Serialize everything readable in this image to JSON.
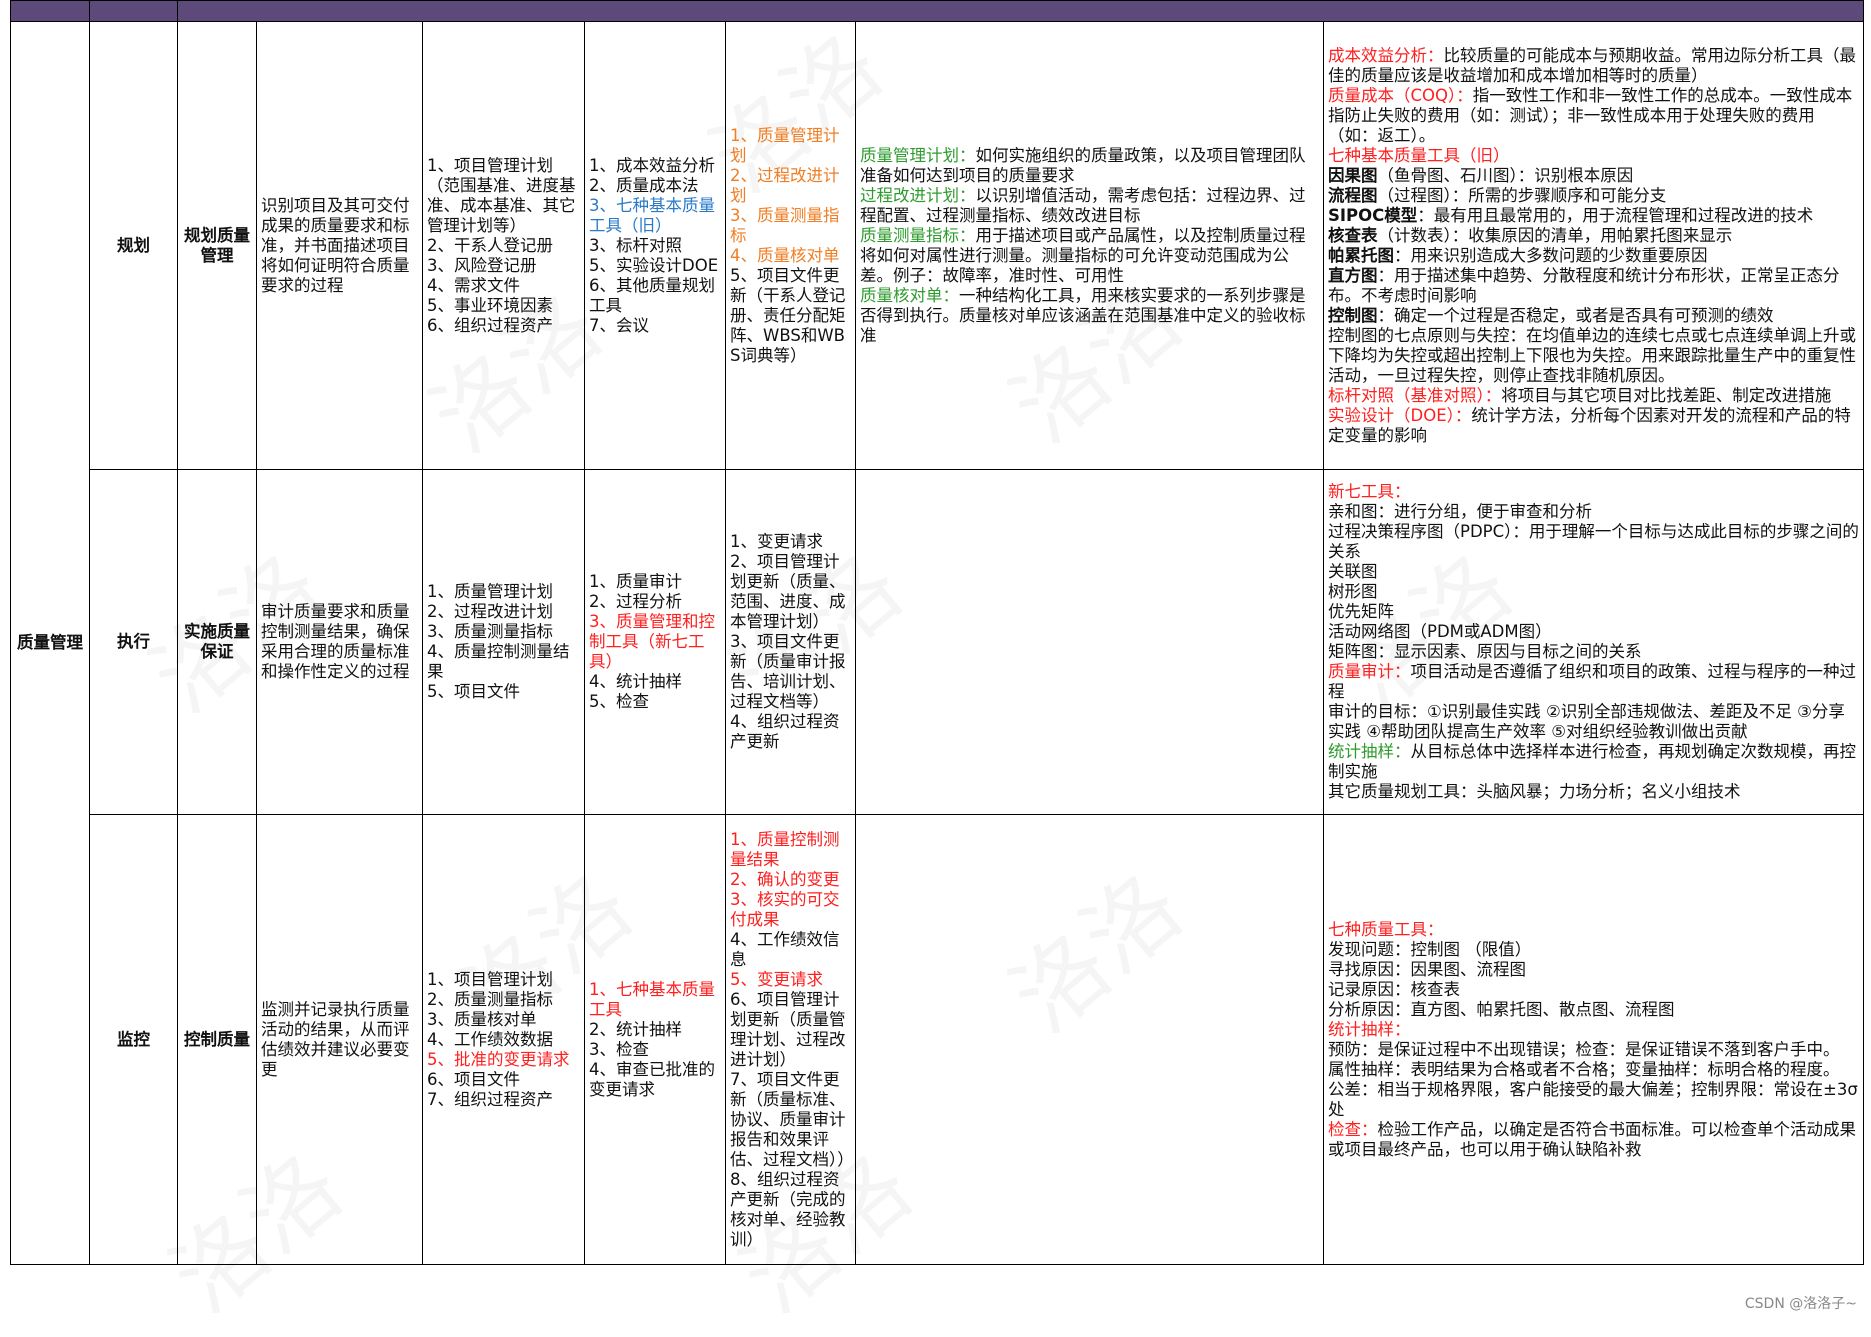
{
  "table": {
    "area_label": "质量管理",
    "rows": [
      {
        "group": "规划",
        "process": "规划质量\n管理",
        "definition": "识别项目及其可交付成果的质量要求和标准，并书面描述项目将如何证明符合质量要求的过程",
        "inputs": [
          {
            "t": "1、项目管理计划（范围基准、进度基准、成本基准、其它管理计划等）"
          },
          {
            "t": "2、干系人登记册"
          },
          {
            "t": "3、风险登记册"
          },
          {
            "t": "4、需求文件"
          },
          {
            "t": "5、事业环境因素"
          },
          {
            "t": "6、组织过程资产"
          }
        ],
        "tools": [
          {
            "t": "1、成本效益分析"
          },
          {
            "t": "2、质量成本法"
          },
          {
            "t": "3、七种基本质量工具（旧）",
            "c": "blue"
          },
          {
            "t": "3、标杆对照"
          },
          {
            "t": "5、实验设计DOE"
          },
          {
            "t": "6、其他质量规划工具"
          },
          {
            "t": "7、会议"
          }
        ],
        "outputs": [
          {
            "t": "1、质量管理计划",
            "c": "orange"
          },
          {
            "t": "2、过程改进计划",
            "c": "orange"
          },
          {
            "t": "3、质量测量指标",
            "c": "orange"
          },
          {
            "t": "4、质量核对单",
            "c": "orange"
          },
          {
            "t": "5、项目文件更新（干系人登记册、责任分配矩阵、WBS和WBS词典等）"
          }
        ],
        "notes": [
          [
            {
              "t": "质量管理计划：",
              "c": "green"
            },
            {
              "t": "如何实施组织的质量政策，以及项目管理团队准备如何达到项目的质量要求"
            }
          ],
          [
            {
              "t": "过程改进计划：",
              "c": "green"
            },
            {
              "t": "以识别增值活动，需考虑包括：过程边界、过程配置、过程测量指标、绩效改进目标"
            }
          ],
          [
            {
              "t": "质量测量指标：",
              "c": "green"
            },
            {
              "t": "用于描述项目或产品属性，以及控制质量过程将如何对属性进行测量。测量指标的可允许变动范围成为公差。例子：故障率，准时性、可用性"
            }
          ],
          [
            {
              "t": "质量核对单：",
              "c": "green"
            },
            {
              "t": "一种结构化工具，用来核实要求的一系列步骤是否得到执行。质量核对单应该涵盖在范围基准中定义的验收标准"
            }
          ]
        ],
        "details": [
          [
            {
              "t": "成本效益分析：",
              "c": "red"
            },
            {
              "t": "比较质量的可能成本与预期收益。常用边际分析工具（最佳的质量应该是收益增加和成本增加相等时的质量）"
            }
          ],
          [
            {
              "t": "质量成本（COQ）：",
              "c": "red"
            },
            {
              "t": "指一致性工作和非一致性工作的总成本。一致性成本指防止失败的费用（如：测试）；非一致性成本用于处理失败的费用（如：返工）。"
            }
          ],
          [
            {
              "t": "七种基本质量工具（旧）",
              "c": "red"
            }
          ],
          [
            {
              "t": "因果图",
              "c": "b"
            },
            {
              "t": "（鱼骨图、石川图）：识别根本原因"
            }
          ],
          [
            {
              "t": "流程图",
              "c": "b"
            },
            {
              "t": "（过程图）：所需的步骤顺序和可能分支"
            }
          ],
          [
            {
              "t": "SIPOC模型",
              "c": "b"
            },
            {
              "t": "：最有用且最常用的，用于流程管理和过程改进的技术"
            }
          ],
          [
            {
              "t": "核查表",
              "c": "b"
            },
            {
              "t": "（计数表）：收集原因的清单，用帕累托图来显示"
            }
          ],
          [
            {
              "t": "帕累托图",
              "c": "b"
            },
            {
              "t": "：用来识别造成大多数问题的少数重要原因"
            }
          ],
          [
            {
              "t": "直方图",
              "c": "b"
            },
            {
              "t": "：用于描述集中趋势、分散程度和统计分布形状，正常呈正态分布。不考虑时间影响"
            }
          ],
          [
            {
              "t": "控制图",
              "c": "b"
            },
            {
              "t": "：确定一个过程是否稳定，或者是否具有可预测的绩效"
            }
          ],
          [
            {
              "t": "控制图的七点原则与失控：在均值单边的连续七点或七点连续单调上升或下降均为失控或超出控制上下限也为失控。用来跟踪批量生产中的重复性活动，一旦过程失控，则停止查找非随机原因。"
            }
          ],
          [
            {
              "t": "标杆对照（基准对照）：",
              "c": "red"
            },
            {
              "t": "将项目与其它项目对比找差距、制定改进措施"
            }
          ],
          [
            {
              "t": "实验设计（DOE）：",
              "c": "red"
            },
            {
              "t": "统计学方法，分析每个因素对开发的流程和产品的特定变量的影响"
            }
          ]
        ]
      },
      {
        "group": "执行",
        "process": "实施质量\n保证",
        "definition": "审计质量要求和质量控制测量结果，确保采用合理的质量标准和操作性定义的过程",
        "inputs": [
          {
            "t": "1、质量管理计划"
          },
          {
            "t": "2、过程改进计划"
          },
          {
            "t": "3、质量测量指标"
          },
          {
            "t": "4、质量控制测量结果"
          },
          {
            "t": "5、项目文件"
          }
        ],
        "tools": [
          {
            "t": "1、质量审计"
          },
          {
            "t": "2、过程分析"
          },
          {
            "t": "3、质量管理和控制工具（新七工具）",
            "c": "red"
          },
          {
            "t": "4、统计抽样"
          },
          {
            "t": "5、检查"
          }
        ],
        "outputs": [
          {
            "t": "1、变更请求"
          },
          {
            "t": "2、项目管理计划更新（质量、范围、进度、成本管理计划）"
          },
          {
            "t": "3、项目文件更新（质量审计报告、培训计划、过程文档等）"
          },
          {
            "t": "4、组织过程资产更新"
          }
        ],
        "notes": [],
        "details": [
          [
            {
              "t": "新七工具：",
              "c": "red"
            }
          ],
          [
            {
              "t": "亲和图：进行分组，便于审查和分析"
            }
          ],
          [
            {
              "t": "过程决策程序图（PDPC）：用于理解一个目标与达成此目标的步骤之间的关系"
            }
          ],
          [
            {
              "t": "关联图"
            }
          ],
          [
            {
              "t": "树形图"
            }
          ],
          [
            {
              "t": "优先矩阵"
            }
          ],
          [
            {
              "t": "活动网络图（PDM或ADM图）"
            }
          ],
          [
            {
              "t": "矩阵图：显示因素、原因与目标之间的关系"
            }
          ],
          [
            {
              "t": "质量审计：",
              "c": "red"
            },
            {
              "t": "项目活动是否遵循了组织和项目的政策、过程与程序的一种过程"
            }
          ],
          [
            {
              "t": "审计的目标：①识别最佳实践 ②识别全部违规做法、差距及不足 ③分享实践 ④帮助团队提高生产效率 ⑤对组织经验教训做出贡献"
            }
          ],
          [
            {
              "t": "统计抽样：",
              "c": "green"
            },
            {
              "t": "从目标总体中选择样本进行检查，再规划确定次数规模，再控制实施"
            }
          ],
          [
            {
              "t": "其它质量规划工具：头脑风暴；力场分析；名义小组技术"
            }
          ]
        ]
      },
      {
        "group": "监控",
        "process": "控制质量",
        "definition": "监测并记录执行质量活动的结果，从而评估绩效并建议必要变更",
        "inputs": [
          {
            "t": "1、项目管理计划"
          },
          {
            "t": "2、质量测量指标"
          },
          {
            "t": "3、质量核对单"
          },
          {
            "t": "4、工作绩效数据"
          },
          {
            "t": "5、批准的变更请求",
            "c": "red"
          },
          {
            "t": "6、项目文件"
          },
          {
            "t": "7、组织过程资产"
          }
        ],
        "tools": [
          {
            "t": "1、七种基本质量工具",
            "c": "red"
          },
          {
            "t": "2、统计抽样"
          },
          {
            "t": "3、检查"
          },
          {
            "t": "4、审查已批准的变更请求"
          }
        ],
        "outputs": [
          {
            "t": "1、质量控制测量结果",
            "c": "red"
          },
          {
            "t": "2、确认的变更",
            "c": "red"
          },
          {
            "t": "3、核实的可交付成果",
            "c": "red"
          },
          {
            "t": "4、工作绩效信息"
          },
          {
            "t": "5、变更请求",
            "c": "red"
          },
          {
            "t": "6、项目管理计划更新（质量管理计划、过程改进计划）"
          },
          {
            "t": "7、项目文件更新（质量标准、协议、质量审计报告和效果评估、过程文档））"
          },
          {
            "t": "8、组织过程资产更新（完成的核对单、经验教训）"
          }
        ],
        "notes": [],
        "details": [
          [
            {
              "t": "七种质量工具：",
              "c": "red"
            }
          ],
          [
            {
              "t": "发现问题：控制图 （限值）"
            }
          ],
          [
            {
              "t": "寻找原因：因果图、流程图"
            }
          ],
          [
            {
              "t": "记录原因：核查表"
            }
          ],
          [
            {
              "t": "分析原因：直方图、帕累托图、散点图、流程图"
            }
          ],
          [
            {
              "t": "统计抽样：",
              "c": "red"
            }
          ],
          [
            {
              "t": "预防：是保证过程中不出现错误；检查：是保证错误不落到客户手中。"
            }
          ],
          [
            {
              "t": "属性抽样：表明结果为合格或者不合格；变量抽样：标明合格的程度。"
            }
          ],
          [
            {
              "t": "公差：相当于规格界限，客户能接受的最大偏差；控制界限：常设在±3σ处"
            }
          ],
          [
            {
              "t": "检查：",
              "c": "red"
            },
            {
              "t": "检验工作产品，以确定是否符合书面标准。可以检查单个活动成果或项目最终产品，也可以用于确认缺陷补救"
            }
          ]
        ]
      }
    ]
  },
  "watermark_text": "洛洛",
  "credit": "CSDN @洛洛子~"
}
